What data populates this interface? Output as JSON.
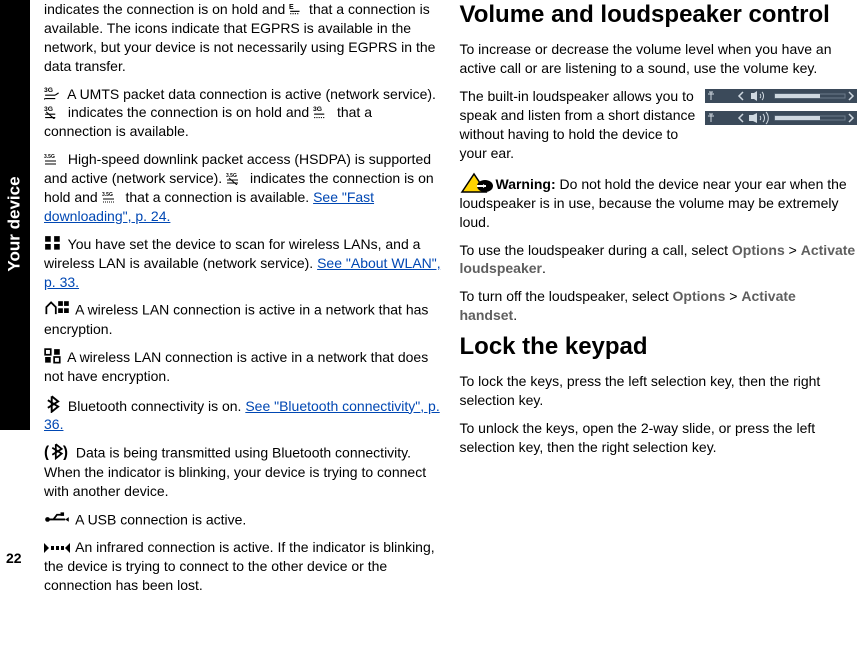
{
  "side_tab": "Your device",
  "page_number": "22",
  "left": {
    "p1": "indicates the connection is on hold and ",
    "p1b": " that a connection is available. The icons indicate that EGPRS is available in the network, but your device is not necessarily using EGPRS in the data transfer.",
    "p2a": " A UMTS packet data connection is active (network service). ",
    "p2b": " indicates the connection is on hold and ",
    "p2c": " that a connection is available.",
    "p3a": " High-speed downlink packet access (HSDPA) is supported and active (network service). ",
    "p3b": " indicates the connection is on hold and ",
    "p3c": " that a connection is available. ",
    "link1": "See \"Fast downloading\", p. 24.",
    "p4a": " You have set the device to scan for wireless LANs, and a wireless LAN is available (network service). ",
    "link2": "See \"About WLAN\", p. 33.",
    "p5": " A wireless LAN connection is active in a network that has encryption.",
    "p6": " A wireless LAN connection is active in a network that does not have encryption.",
    "p7a": " Bluetooth connectivity is on. ",
    "link3": "See \"Bluetooth connectivity\", p. 36.",
    "p8": " Data is being transmitted using Bluetooth connectivity. When the indicator is blinking, your device is trying to connect with another device.",
    "p9": " A USB connection is active.",
    "p10": " An infrared connection is active. If the indicator is blinking, the device is trying to connect to the other device or the connection has been lost."
  },
  "right": {
    "h1": "Volume and loudspeaker control",
    "p1": "To increase or decrease the volume level when you have an active call or are listening to a sound, use the volume key.",
    "p2": "The built-in loudspeaker allows you to speak and listen from a short distance without having to hold the device to your ear.",
    "warn_label": "Warning:",
    "warn": "  Do not hold the device near your ear when the loudspeaker is in use, because the volume may be extremely loud.",
    "p3a": "To use the loudspeaker during a call, select ",
    "opt": "Options",
    "gt": " > ",
    "act_loud": "Activate loudspeaker",
    "p3b": ".",
    "p4a": "To turn off the loudspeaker, select ",
    "act_hand": "Activate handset",
    "p4b": ".",
    "h2": "Lock the keypad",
    "p5": "To lock the keys, press the left selection key, then the right selection key.",
    "p6": "To unlock the keys, open the 2-way slide, or press the left selection key, then the right selection key."
  }
}
